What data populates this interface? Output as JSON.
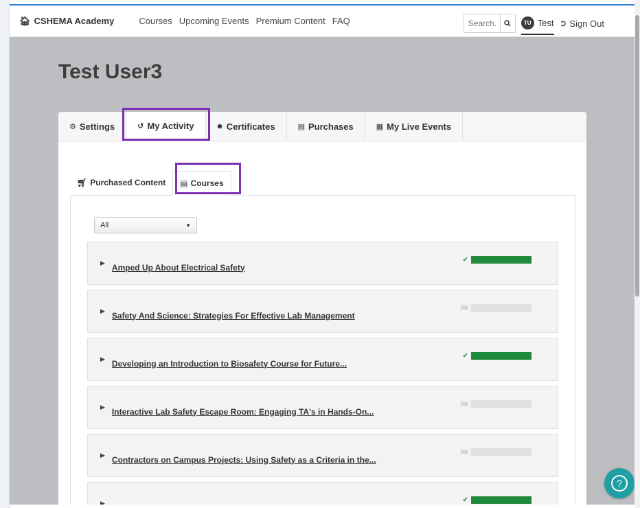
{
  "brand": {
    "name": "CSHEMA Academy",
    "icon": "home-icon"
  },
  "nav": {
    "links": [
      "Courses",
      "Upcoming Events",
      "Premium Content",
      "FAQ"
    ]
  },
  "search": {
    "placeholder": "Search...",
    "icon": "search-icon"
  },
  "user": {
    "initials": "TU",
    "name": "Test"
  },
  "signout": {
    "label": "Sign Out",
    "icon": "sign-out-icon"
  },
  "page": {
    "title": "Test User3"
  },
  "main_tabs": [
    {
      "label": "Settings",
      "icon": "gear-icon"
    },
    {
      "label": "My Activity",
      "icon": "history-icon",
      "active": true
    },
    {
      "label": "Certificates",
      "icon": "certificate-icon"
    },
    {
      "label": "Purchases",
      "icon": "credit-card-icon"
    },
    {
      "label": "My Live Events",
      "icon": "calendar-icon"
    }
  ],
  "sub_tabs": [
    {
      "label": "Purchased Content",
      "icon": "cart-icon"
    },
    {
      "label": "Courses",
      "icon": "book-icon",
      "active": true
    }
  ],
  "filter": {
    "selected": "All"
  },
  "courses": [
    {
      "title": "Amped Up About Electrical Safety",
      "complete": true,
      "progress": 100,
      "progress_label": ""
    },
    {
      "title": "Safety And Science: Strategies For Effective Lab Management",
      "complete": false,
      "progress": 0,
      "progress_label": "0%"
    },
    {
      "title": "Developing an Introduction to Biosafety Course for Future...",
      "complete": true,
      "progress": 100,
      "progress_label": ""
    },
    {
      "title": "Interactive Lab Safety Escape Room: Engaging TA's in Hands-On...",
      "complete": false,
      "progress": 0,
      "progress_label": "0%"
    },
    {
      "title": "Contractors on Campus Projects: Using Safety as a Criteria in the...",
      "complete": false,
      "progress": 0,
      "progress_label": "0%"
    },
    {
      "title": "Developing a Standardized Safety Approach to Instructional...",
      "complete": true,
      "progress": 100,
      "progress_label": ""
    }
  ],
  "colors": {
    "highlight": "#7d2fb5",
    "progress_fill": "#1e8a3a",
    "active_tab_underline": "#2b63c9",
    "help_button": "#1f9fa3"
  },
  "help": {
    "icon": "question-icon"
  }
}
